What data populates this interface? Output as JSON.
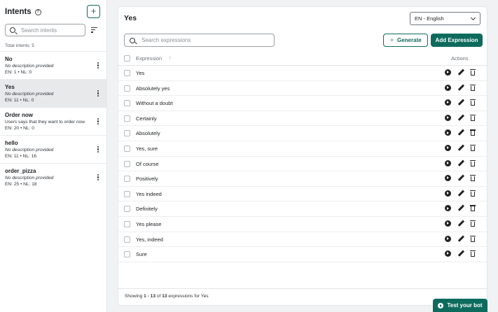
{
  "sidebar": {
    "title": "Intents",
    "add_label": "+",
    "search_placeholder": "Search intents",
    "total_label": "Total intents: 5",
    "intents": [
      {
        "name": "No",
        "description": "No description provided",
        "counts": "EN: 1 • NL: 0"
      },
      {
        "name": "Yes",
        "description": "No description provided",
        "counts": "EN: 11 • NL: 0"
      },
      {
        "name": "Order now",
        "description": "Users says that they want to order now",
        "counts": "EN: 20 • NL: 0"
      },
      {
        "name": "hello",
        "description": "No description provided",
        "counts": "EN: 11 • NL: 16"
      },
      {
        "name": "order_pizza",
        "description": "No description provided",
        "counts": "EN: 25 • NL: 18"
      }
    ]
  },
  "main": {
    "title": "Yes",
    "language": "EN - English",
    "search_placeholder": "Search expressions",
    "generate_label": "Generate",
    "add_expression_label": "Add Expression",
    "columns": {
      "expression": "Expression",
      "actions": "Actions"
    },
    "expressions": [
      "Yes",
      "Absolutely yes",
      "Without a doubt",
      "Certainly",
      "Absolutely",
      "Yes, sure",
      "Of course",
      "Positively",
      "Yes indeed",
      "Definitely",
      "Yes please",
      "Yes, indeed",
      "Sure"
    ],
    "footer": {
      "prefix": "Showing ",
      "range": "1 - 13",
      "mid": " of ",
      "total": "13",
      "suffix": " expressions for Yes"
    }
  },
  "test_bot_label": "Test your bot",
  "colors": {
    "accent": "#0d6b5e"
  }
}
